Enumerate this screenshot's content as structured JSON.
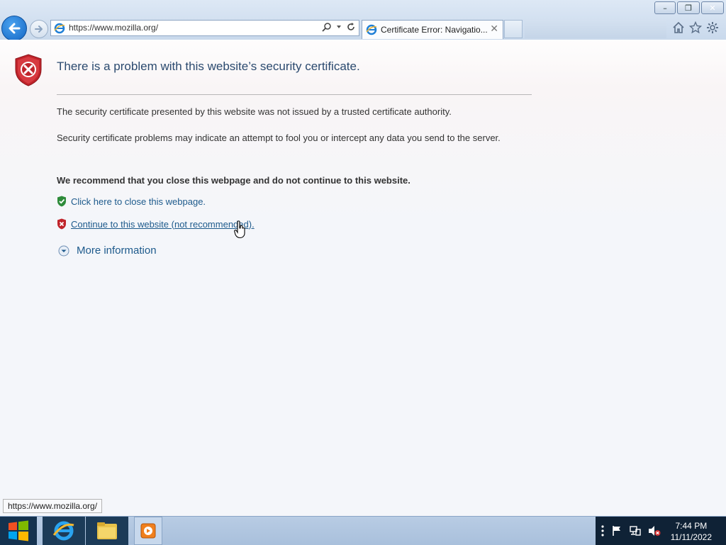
{
  "window": {
    "minimize_label": "–",
    "restore_label": "❐",
    "close_label": "✕"
  },
  "navigation": {
    "address": "https://www.mozilla.org/",
    "back_icon": "back-arrow-icon",
    "forward_icon": "forward-arrow-icon"
  },
  "tab": {
    "title": "Certificate Error: Navigatio...",
    "close_label": "✕"
  },
  "page": {
    "title": "There is a problem with this website’s security certificate.",
    "p1": "The security certificate presented by this website was not issued by a trusted certificate authority.",
    "p2": "Security certificate problems may indicate an attempt to fool you or intercept any data you send to the server.",
    "recommendation": "We recommend that you close this webpage and do not continue to this website.",
    "close_link": "Click here to close this webpage.",
    "continue_link": "Continue to this website (not recommended).",
    "more_info": "More information"
  },
  "status": {
    "hover_url": "https://www.mozilla.org/"
  },
  "taskbar": {
    "time": "7:44 PM",
    "date": "11/11/2022"
  },
  "colors": {
    "link": "#1d5a8c",
    "title": "#2b4a6f",
    "error_shield": "#c0242b",
    "ok_shield": "#2e8b3a"
  }
}
